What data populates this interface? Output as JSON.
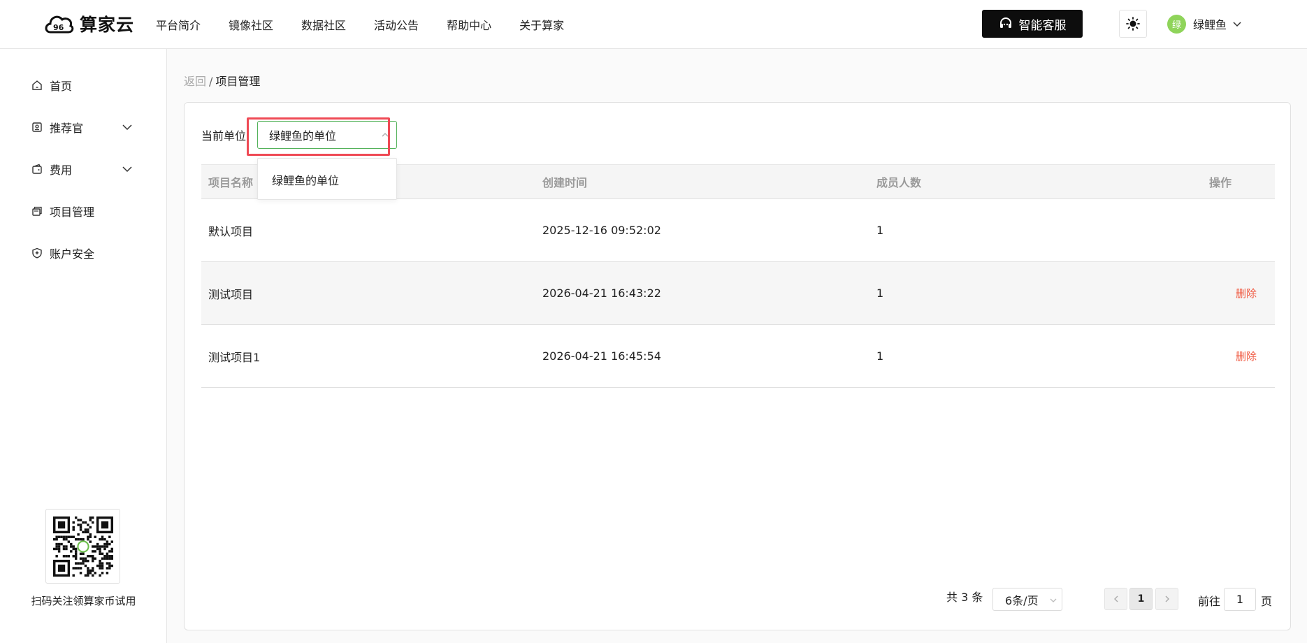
{
  "brand": {
    "name": "算家云"
  },
  "nav": [
    {
      "label": "平台简介"
    },
    {
      "label": "镜像社区"
    },
    {
      "label": "数据社区"
    },
    {
      "label": "活动公告"
    },
    {
      "label": "帮助中心"
    },
    {
      "label": "关于算家"
    }
  ],
  "header": {
    "service_label": "智能客服",
    "user_avatar": "绿",
    "user_name": "绿鲤鱼"
  },
  "sidebar": {
    "items": [
      {
        "label": "首页",
        "icon": "home-icon"
      },
      {
        "label": "推荐官",
        "icon": "badge-icon",
        "expandable": true
      },
      {
        "label": "费用",
        "icon": "wallet-icon",
        "expandable": true
      },
      {
        "label": "项目管理",
        "icon": "folder-icon"
      },
      {
        "label": "账户安全",
        "icon": "shield-icon"
      }
    ],
    "qr_caption": "扫码关注领算家币试用"
  },
  "breadcrumb": {
    "back": "返回",
    "separator": "/",
    "current": "项目管理"
  },
  "unit": {
    "label": "当前单位",
    "selected": "绿鲤鱼的单位",
    "options": [
      "绿鲤鱼的单位"
    ]
  },
  "table": {
    "headers": [
      "项目名称",
      "创建时间",
      "成员人数",
      "操作"
    ],
    "rows": [
      {
        "name": "默认项目",
        "created": "2025-12-16 09:52:02",
        "members": "1",
        "action": ""
      },
      {
        "name": "测试项目",
        "created": "2026-04-21 16:43:22",
        "members": "1",
        "action": "删除"
      },
      {
        "name": "测试项目1",
        "created": "2026-04-21 16:45:54",
        "members": "1",
        "action": "删除"
      }
    ]
  },
  "pagination": {
    "total": "共 3 条",
    "page_size": "6条/页",
    "current_page": "1",
    "goto_label": "前往",
    "goto_value": "1",
    "page_unit": "页"
  },
  "colors": {
    "accent_green": "#53b25a",
    "highlight_red": "#ef4a55",
    "delete_red": "#f05a42",
    "dark_button": "#0d0d0d"
  }
}
